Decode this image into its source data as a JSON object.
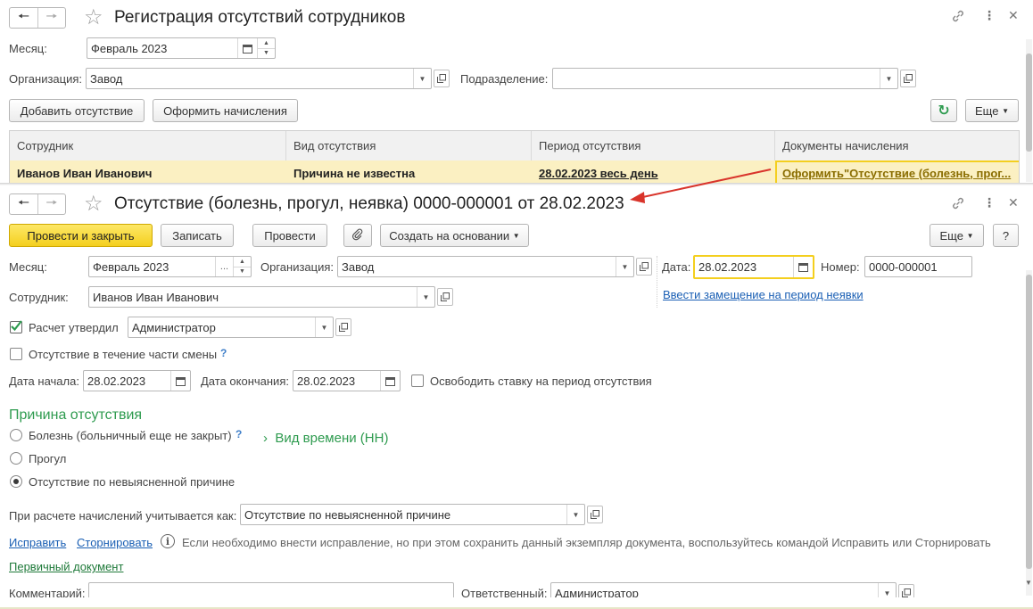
{
  "back_window": {
    "title": "Регистрация отсутствий сотрудников",
    "month_label": "Месяц:",
    "month_value": "Февраль 2023",
    "org_label": "Организация:",
    "org_value": "Завод",
    "dept_label": "Подразделение:",
    "dept_value": "",
    "add_absence_button": "Добавить отсутствие",
    "make_accruals_button": "Оформить начисления",
    "more_button": "Еще",
    "table": {
      "columns": [
        "Сотрудник",
        "Вид отсутствия",
        "Период отсутствия",
        "Документы начисления"
      ],
      "rows": [
        [
          "Иванов Иван Иванович",
          "Причина не известна",
          "28.02.2023 весь день",
          "Оформить\"Отсутствие (болезнь, прог..."
        ]
      ]
    }
  },
  "front_window": {
    "title": "Отсутствие (болезнь, прогул, неявка) 0000-000001 от 28.02.2023",
    "toolbar": {
      "post_close": "Провести и закрыть",
      "save": "Записать",
      "post": "Провести",
      "create_based_on": "Создать на основании",
      "more": "Еще",
      "help": "?"
    },
    "month_label": "Месяц:",
    "month_value": "Февраль 2023",
    "org_label": "Организация:",
    "org_value": "Завод",
    "date_label": "Дата:",
    "date_value": "28.02.2023",
    "number_label": "Номер:",
    "number_value": "0000-000001",
    "substitution_link": "Ввести замещение на период неявки",
    "employee_label": "Сотрудник:",
    "employee_value": "Иванов Иван Иванович",
    "approved_label": "Расчет утвердил",
    "approved_checked": true,
    "approved_value": "Администратор",
    "partial_shift_label": "Отсутствие в течение части смены",
    "start_label": "Дата начала:",
    "start_value": "28.02.2023",
    "end_label": "Дата окончания:",
    "end_value": "28.02.2023",
    "free_rate_label": "Освободить ставку на период отсутствия",
    "reason_heading": "Причина отсутствия",
    "reasons": [
      {
        "label": "Болезнь (больничный еще не закрыт)",
        "selected": false
      },
      {
        "label": "Прогул",
        "selected": false
      },
      {
        "label": "Отсутствие по невыясненной причине",
        "selected": true
      }
    ],
    "time_type_label": "Вид времени (НН)",
    "calc_label": "При расчете начислений учитывается как:",
    "calc_value": "Отсутствие по невыясненной причине",
    "fix_link": "Исправить",
    "storno_link": "Сторнировать",
    "info_text": "Если необходимо внести исправление, но при этом сохранить данный экземпляр документа, воспользуйтесь командой Исправить или Сторнировать",
    "primary_doc_link": "Первичный документ",
    "comment_label": "Комментарий:",
    "comment_value": "",
    "responsible_label": "Ответственный:",
    "responsible_value": "Администратор"
  },
  "colors": {
    "accent_yellow": "#f4cf1e",
    "row_highlight": "#fbf0c2",
    "link_blue": "#1a5fb4",
    "section_green": "#2e9b4f",
    "arrow_red": "#d9342b"
  }
}
